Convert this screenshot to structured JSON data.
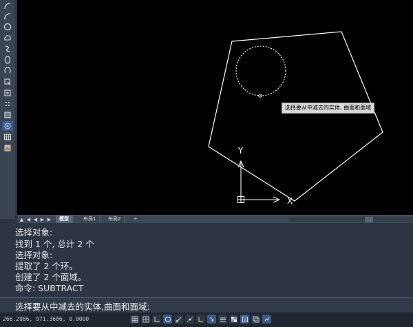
{
  "left_toolbar": {
    "tools": [
      {
        "icon": "arc-icon"
      },
      {
        "icon": "arc-icon"
      },
      {
        "icon": "circle-icon"
      },
      {
        "icon": "cloud-icon"
      },
      {
        "icon": "spline-icon"
      },
      {
        "icon": "ellipse-icon"
      },
      {
        "icon": "ellipse-arc-icon"
      },
      {
        "icon": "insert-block-icon"
      },
      {
        "icon": "create-block-icon"
      },
      {
        "icon": "point-icon"
      },
      {
        "icon": "hatch-icon"
      },
      {
        "icon": "region-icon"
      },
      {
        "icon": "table-icon"
      },
      {
        "icon": "image-icon"
      }
    ]
  },
  "canvas": {
    "background": "#000000",
    "tooltip": "选择要从中减去的实体, 曲面和面域",
    "ucs": {
      "x_label": "X",
      "y_label": "Y"
    }
  },
  "tab_bar": {
    "nav_arrows": [
      "▲",
      "◀",
      "◀",
      "▶",
      "▶"
    ],
    "tabs": [
      {
        "label": "模型",
        "active": true
      },
      {
        "label": "布局1",
        "active": false
      },
      {
        "label": "布局2",
        "active": false
      }
    ],
    "add_tab": "+"
  },
  "command_history": [
    "选择对象:",
    "找到 1 个, 总计 2 个",
    "选择对象:",
    "提取了 2 个环。",
    "创建了 2 个面域。",
    "命令: SUBTRACT"
  ],
  "command_line": {
    "value": "选择要从中减去的实体,曲面和面域:"
  },
  "status_bar": {
    "coordinates": "266.2986, 971.3686, 0.0000",
    "buttons": [
      {
        "icon": "grid-icon",
        "on": false
      },
      {
        "icon": "snap-icon",
        "on": false
      },
      {
        "icon": "ortho-icon",
        "on": false
      },
      {
        "icon": "polar-tracking-icon",
        "on": true
      },
      {
        "icon": "object-snap-icon",
        "on": false
      },
      {
        "icon": "snap-tracking-icon",
        "on": false
      },
      {
        "icon": "dynamic-ucs-icon",
        "on": false
      },
      {
        "icon": "dynamic-input-icon",
        "on": true
      },
      {
        "icon": "lineweight-icon",
        "on": false
      },
      {
        "icon": "transparency-icon",
        "on": false
      },
      {
        "icon": "quick-properties-icon",
        "on": true
      },
      {
        "icon": "selection-cycling-icon",
        "on": false
      },
      {
        "icon": "annotation-monitor-icon",
        "on": true
      }
    ]
  },
  "colors": {
    "accent": "#3d5a86",
    "panel": "#2c3541",
    "drawing_line": "#ffffff"
  }
}
